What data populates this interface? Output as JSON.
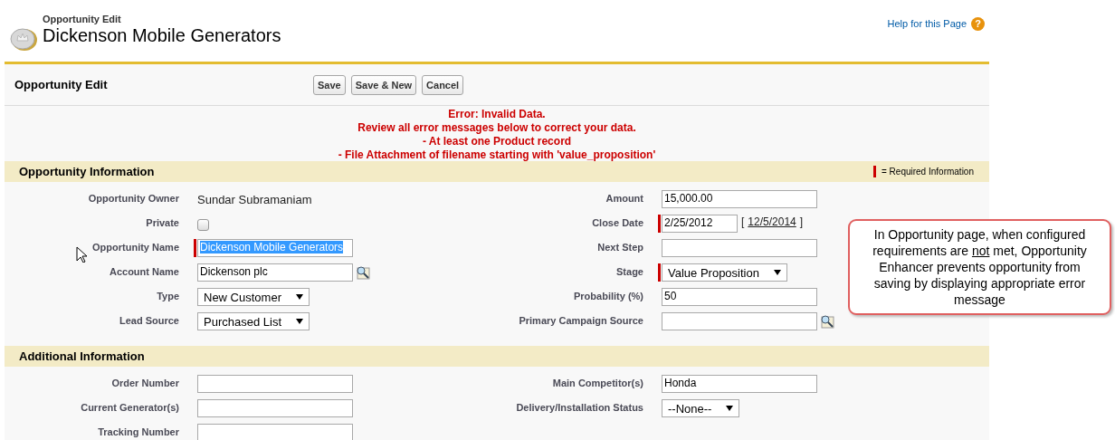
{
  "header": {
    "subtitle": "Opportunity Edit",
    "title": "Dickenson Mobile Generators",
    "help_link": "Help for this Page",
    "help_icon": "?"
  },
  "panel": {
    "title": "Opportunity Edit",
    "buttons": [
      "Save",
      "Save & New",
      "Cancel"
    ]
  },
  "errors": [
    "Error: Invalid Data.",
    "Review all error messages below to correct your data.",
    "- At least one Product record",
    "- File Attachment of filename starting with 'value_proposition'"
  ],
  "sections": [
    {
      "title": "Opportunity Information",
      "legend": "= Required Information",
      "rows": [
        {
          "left": {
            "label": "Opportunity Owner",
            "kind": "text",
            "value": "Sundar Subramaniam",
            "required": false
          },
          "right": {
            "label": "Amount",
            "kind": "input",
            "value": "15,000.00",
            "required": false
          }
        },
        {
          "left": {
            "label": "Private",
            "kind": "checkbox",
            "checked": false,
            "required": false
          },
          "right": {
            "label": "Close Date",
            "kind": "date",
            "value": "2/25/2012",
            "required": true,
            "today_open": "[",
            "today_link": "12/5/2014",
            "today_close": "]"
          }
        },
        {
          "left": {
            "label": "Opportunity Name",
            "kind": "input",
            "value": "Dickenson Mobile Generators",
            "required": true,
            "selected": true
          },
          "right": {
            "label": "Next Step",
            "kind": "input",
            "required": false
          }
        },
        {
          "left": {
            "label": "Account Name",
            "kind": "lookup",
            "value": "Dickenson plc",
            "required": false
          },
          "right": {
            "label": "Stage",
            "kind": "select",
            "value": "Value Proposition",
            "required": true
          }
        },
        {
          "left": {
            "label": "Type",
            "kind": "select",
            "value": "New Customer",
            "required": false
          },
          "right": {
            "label": "Probability (%)",
            "kind": "input",
            "value": "50",
            "required": false
          }
        },
        {
          "left": {
            "label": "Lead Source",
            "kind": "select",
            "value": "Purchased List",
            "required": false
          },
          "right": {
            "label": "Primary Campaign Source",
            "kind": "lookup",
            "required": false
          }
        }
      ]
    },
    {
      "title": "Additional Information",
      "rows": [
        {
          "left": {
            "label": "Order Number",
            "kind": "input",
            "required": false
          },
          "right": {
            "label": "Main Competitor(s)",
            "kind": "input",
            "value": "Honda",
            "required": false
          }
        },
        {
          "left": {
            "label": "Current Generator(s)",
            "kind": "input",
            "required": false
          },
          "right": {
            "label": "Delivery/Installation Status",
            "kind": "select",
            "value": "--None--",
            "required": false
          }
        },
        {
          "left": {
            "label": "Tracking Number",
            "kind": "input",
            "required": false
          }
        }
      ]
    }
  ],
  "callout": {
    "before": "In Opportunity page, when configured requirements are ",
    "emphasis": "not",
    "after": " met, Opportunity Enhancer prevents opportunity from saving by displaying appropriate error message"
  }
}
